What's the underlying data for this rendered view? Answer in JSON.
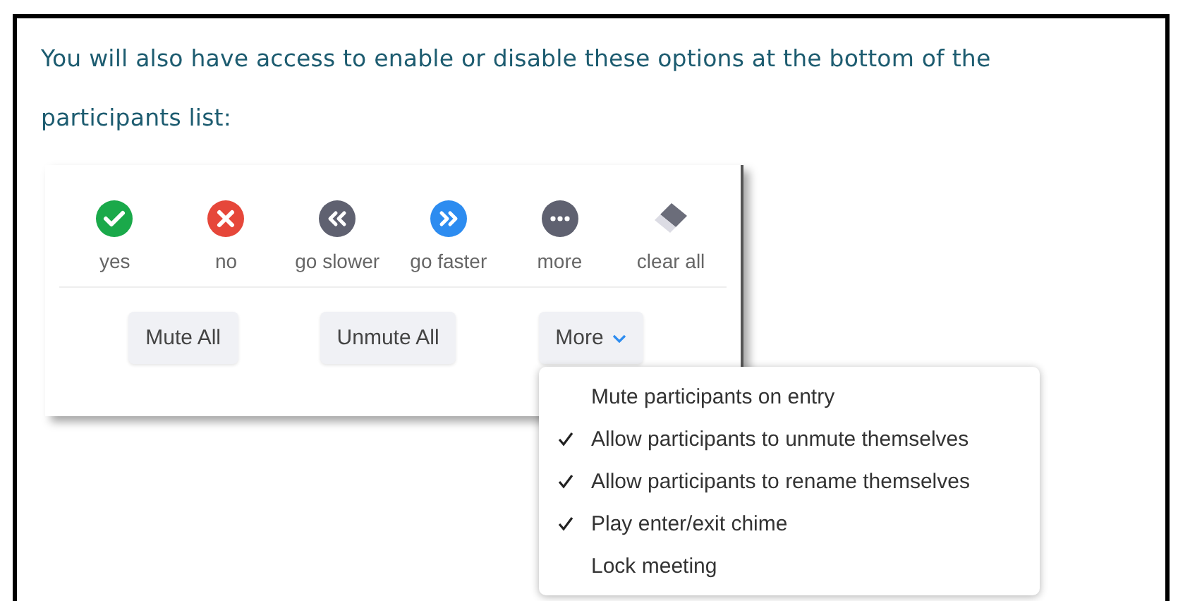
{
  "intro": "You will also have access to enable or disable these options at the bottom of the participants list:",
  "reactions": [
    {
      "kind": "check",
      "label": "yes",
      "color": "#1aa94a"
    },
    {
      "kind": "cross",
      "label": "no",
      "color": "#e6473a"
    },
    {
      "kind": "rewind",
      "label": "go slower",
      "color": "#5f6170"
    },
    {
      "kind": "forward",
      "label": "go faster",
      "color": "#2d8cf0"
    },
    {
      "kind": "dots",
      "label": "more",
      "color": "#5f6170"
    },
    {
      "kind": "eraser",
      "label": "clear all",
      "color": "#6b6d7a"
    }
  ],
  "buttons": [
    {
      "label": "Mute All",
      "dropdown": false
    },
    {
      "label": "Unmute All",
      "dropdown": false
    },
    {
      "label": "More",
      "dropdown": true
    }
  ],
  "menu": [
    {
      "label": "Mute participants on entry",
      "checked": false
    },
    {
      "label": "Allow participants to unmute themselves",
      "checked": true
    },
    {
      "label": "Allow participants to rename themselves",
      "checked": true
    },
    {
      "label": "Play enter/exit chime",
      "checked": true
    },
    {
      "label": "Lock meeting",
      "checked": false
    }
  ]
}
